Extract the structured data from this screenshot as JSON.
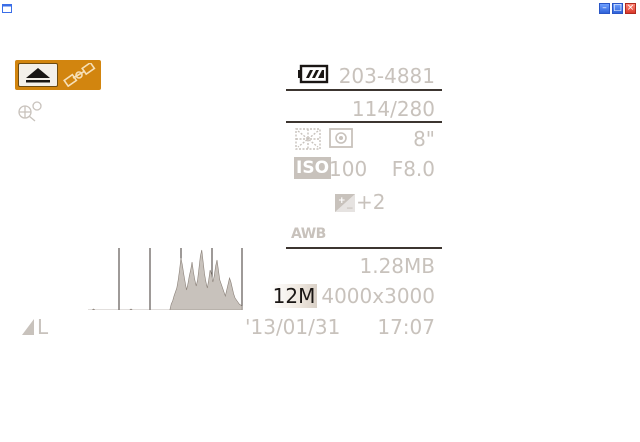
{
  "window": {
    "icons": [
      "window-menu-icon",
      "minimize-icon",
      "maximize-icon",
      "close-icon"
    ]
  },
  "overlay": {
    "icons": [
      "eject-icon",
      "gps-satellite-icon",
      "geotag-icon",
      "battery-icon",
      "metering-icon",
      "focus-area-icon",
      "exposure-comp-icon",
      "histogram-icon",
      "quality-icon"
    ]
  },
  "info": {
    "folder_file": "203-4881",
    "image_index": "114/280",
    "shutter": "8\"",
    "iso_label": "ISO",
    "iso_value": "100",
    "aperture": "F8.0",
    "exposure_comp": "+2",
    "white_balance": "AWB",
    "file_size": "1.28MB",
    "megapixels": "12M",
    "resolution": "4000x3000",
    "date": "'13/01/31",
    "time": "17:07",
    "quality_letter": "L"
  },
  "histogram": [
    0,
    0,
    0,
    0,
    1,
    0,
    0,
    0,
    0,
    0,
    0,
    0,
    0,
    0,
    0,
    0,
    0,
    0,
    0,
    0,
    0,
    0,
    0,
    0,
    0,
    0,
    0,
    0,
    0,
    0,
    0,
    1,
    0,
    0,
    0,
    0,
    0,
    0,
    0,
    0,
    0,
    0,
    0,
    0,
    0,
    0,
    0,
    0,
    0,
    0,
    0,
    0,
    0,
    0,
    0,
    0,
    0,
    0,
    0,
    0,
    6,
    9,
    14,
    18,
    22,
    30,
    40,
    52,
    45,
    36,
    28,
    20,
    26,
    34,
    40,
    48,
    38,
    30,
    24,
    30,
    42,
    54,
    60,
    48,
    36,
    28,
    22,
    30,
    40,
    36,
    28,
    34,
    44,
    50,
    40,
    30,
    26,
    22,
    18,
    14,
    20,
    26,
    32,
    28,
    22,
    16,
    12,
    10,
    8,
    6,
    5,
    4
  ]
}
